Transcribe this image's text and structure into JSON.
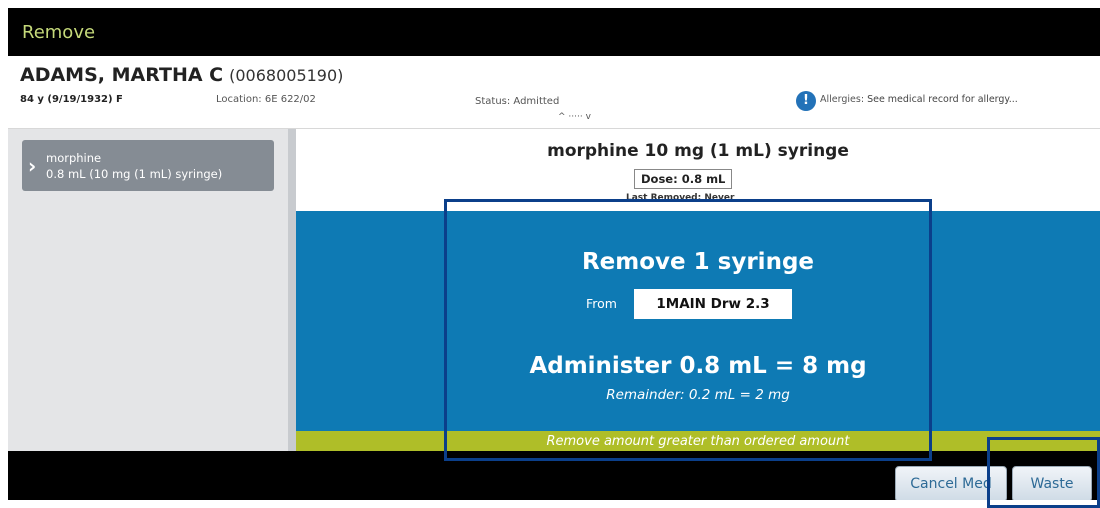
{
  "window": {
    "title": "Remove"
  },
  "patient": {
    "name": "ADAMS, MARTHA C",
    "id": "(0068005190)",
    "age_dob_sex": "84 y (9/19/1932) F",
    "location": "Location: 6E 622/02",
    "status": "Status: Admitted",
    "expander": "^ ····· v",
    "allergy_icon": "!",
    "allergies_label": "Allergies:",
    "allergies_text": "See medical record for allergy..."
  },
  "sidebar": {
    "items": [
      {
        "chevron": "›",
        "name": "morphine",
        "detail": "0.8 mL (10 mg (1 mL) syringe)"
      }
    ]
  },
  "main": {
    "drug_title": "morphine 10 mg (1 mL) syringe",
    "dose": "Dose: 0.8 mL",
    "last_removed": "Last Removed: Never",
    "remove_instruction": "Remove 1 syringe",
    "from_label": "From",
    "location_badge": "1MAIN Drw 2.3",
    "administer": "Administer 0.8 mL = 8 mg",
    "remainder": "Remainder:  0.2 mL = 2 mg",
    "warning": "Remove amount greater than ordered amount"
  },
  "footer": {
    "cancel_label": "Cancel Med",
    "waste_label": "Waste"
  },
  "colors": {
    "title_text": "#c5d97a",
    "instruction_panel": "#0e7ab4",
    "warning_bar": "#afbe28",
    "highlight_box": "#0b3f8a",
    "sidebar_item": "#858c94"
  },
  "icons": {
    "allergy": "info-icon",
    "sidebar_chevron": "chevron-right-icon"
  }
}
